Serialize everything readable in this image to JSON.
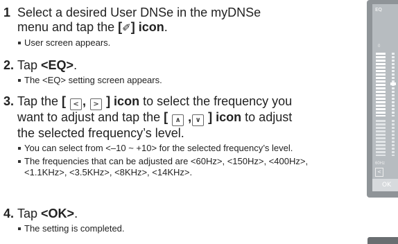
{
  "steps": [
    {
      "num": "1",
      "line1": "Select a desired User DNSe in the myDNSe",
      "line2a": "menu and tap the ",
      "bracket_open": "[",
      "pen_icon": "✐",
      "bracket_close": "]",
      "icon_word": " icon",
      "period": ".",
      "bullets": [
        "User screen appears."
      ]
    },
    {
      "num": "2.",
      "tap": "Tap ",
      "target": "<EQ>",
      "period": ".",
      "bullets": [
        "The <EQ> setting screen appears."
      ]
    },
    {
      "num": "3.",
      "tap": "Tap the ",
      "b_open1": "[ ",
      "left_icon": "<",
      "comma1": ", ",
      "right_icon": ">",
      "icon_close1": " ] icon",
      "mid1": " to select the frequency you",
      "line2a": "want to adjust and tap the ",
      "b_open2": "[ ",
      "up_icon": "∧",
      "comma2": " ,",
      "down_icon": "∨",
      "icon_close2": " ] icon",
      "line2b": " to adjust",
      "line3": "the selected frequency’s level.",
      "bullets": [
        "You can select from <–10 ~ +10> for the selected frequency’s level.",
        "The frequencies that can be adjusted are <60Hz>, <150Hz>, <400Hz>, <1.1KHz>, <3.5KHz>, <8KHz>, <14KHz>."
      ]
    },
    {
      "num": "4.",
      "tap": "Tap ",
      "target": "<OK>",
      "period": ".",
      "bullets": [
        "The setting is completed."
      ]
    }
  ],
  "device": {
    "eq_label": "EQ",
    "zero_label": "0",
    "hz_label": "60Hz",
    "left_icon": "<",
    "ok_label": "OK"
  }
}
